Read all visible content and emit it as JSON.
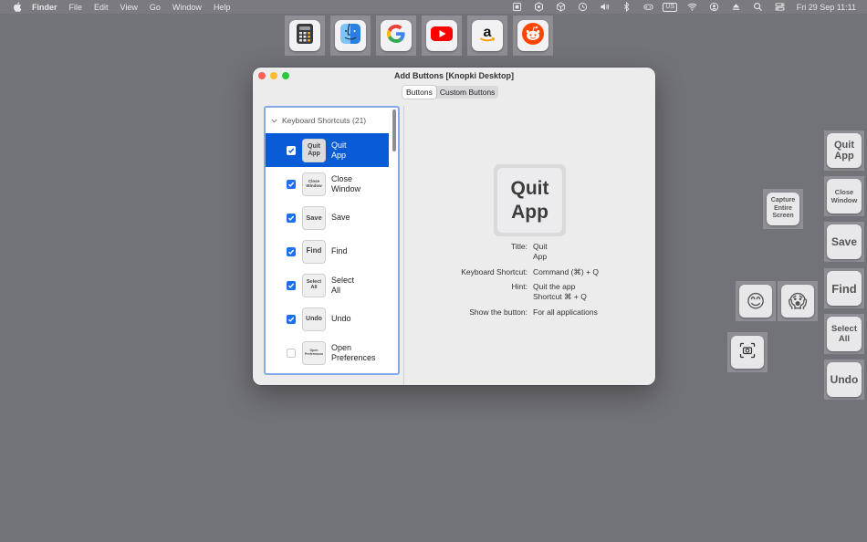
{
  "menubar": {
    "app_name": "Finder",
    "menus": [
      "File",
      "Edit",
      "View",
      "Go",
      "Window",
      "Help"
    ],
    "input_source": "US",
    "clock": "Fri 29 Sep  11:11"
  },
  "top_dock": {
    "items": [
      {
        "icon": "calculator-icon"
      },
      {
        "icon": "finder-icon"
      },
      {
        "icon": "google-icon"
      },
      {
        "icon": "youtube-icon"
      },
      {
        "icon": "amazon-icon"
      },
      {
        "icon": "reddit-icon"
      }
    ]
  },
  "window": {
    "title": "Add Buttons [Knopki Desktop]",
    "tabs": [
      {
        "label": "Buttons",
        "active": true
      },
      {
        "label": "Custom Buttons",
        "active": false
      }
    ],
    "group_header": "Keyboard Shortcuts (21)",
    "items": [
      {
        "thumb": "Quit\nApp",
        "name": "Quit\nApp",
        "checked": true,
        "selected": true
      },
      {
        "thumb": "Close\nWindow",
        "name": "Close\nWindow",
        "checked": true,
        "selected": false
      },
      {
        "thumb": "Save",
        "name": "Save",
        "checked": true,
        "selected": false
      },
      {
        "thumb": "Find",
        "name": "Find",
        "checked": true,
        "selected": false
      },
      {
        "thumb": "Select\nAll",
        "name": "Select\nAll",
        "checked": true,
        "selected": false
      },
      {
        "thumb": "Undo",
        "name": "Undo",
        "checked": true,
        "selected": false
      },
      {
        "thumb": "Open\nPreferences",
        "name": "Open\nPreferences",
        "checked": false,
        "selected": false
      }
    ],
    "detail": {
      "big_button": "Quit\nApp",
      "title_label": "Title:",
      "title_value": "Quit\nApp",
      "shortcut_label": "Keyboard Shortcut:",
      "shortcut_value": "Command (⌘) + Q",
      "hint_label": "Hint:",
      "hint_value": "Quit the app\nShortcut ⌘ + Q",
      "show_label": "Show the button:",
      "show_value": "For all applications"
    }
  },
  "floating_keys": {
    "capture": "Capture\nEntire\nScreen",
    "quit": "Quit\nApp",
    "close": "Close\nWindow",
    "save": "Save",
    "find": "Find",
    "select_all": "Select\nAll",
    "undo": "Undo",
    "emoji_smile": "😊",
    "emoji_scream": "😱",
    "screenshot_icon": "camera-viewfinder-icon"
  },
  "colors": {
    "desktop": "#727279",
    "selection": "#0a5bd6",
    "checkbox": "#1d6ff2",
    "list_focus_ring": "#85a8e8",
    "close_light": "#ff5f57",
    "min_light": "#febc2e",
    "zoom_light": "#28c840"
  }
}
